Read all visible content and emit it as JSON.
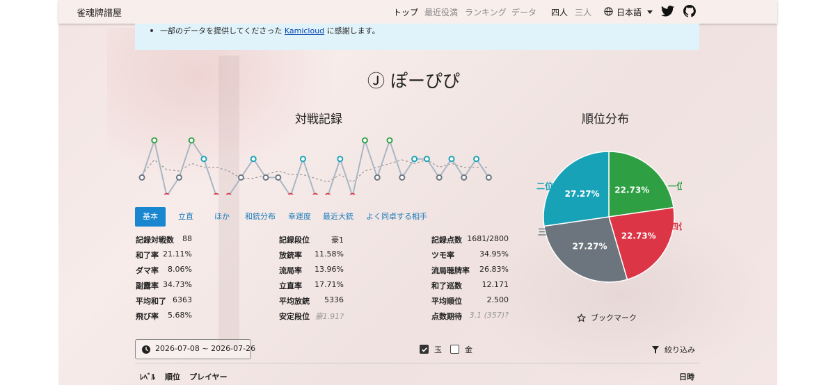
{
  "header": {
    "brand": "雀魂牌譜屋",
    "nav": [
      {
        "label": "トップ",
        "active": true
      },
      {
        "label": "最近役満",
        "active": false
      },
      {
        "label": "ランキング",
        "active": false
      },
      {
        "label": "データ",
        "active": false
      }
    ],
    "modes": [
      {
        "label": "四人",
        "active": true
      },
      {
        "label": "三人",
        "active": false
      }
    ],
    "language": "日本語",
    "icons": [
      "globe-icon",
      "twitter-icon",
      "github-icon"
    ]
  },
  "notice": {
    "prefix": "一部のデータを提供してくださった",
    "link": "Kamicloud",
    "suffix": "に感謝します。"
  },
  "player": {
    "rank_symbol": "Ⓙ",
    "name": "ぽーぴぴ",
    "title": "Ⓙ ぽーぴぴ"
  },
  "sections": {
    "record": "対戦記録",
    "rank_dist": "順位分布"
  },
  "tabs": [
    {
      "label": "基本",
      "active": true
    },
    {
      "label": "立直",
      "active": false
    },
    {
      "label": "ほか",
      "active": false
    },
    {
      "label": "和銃分布",
      "active": false
    },
    {
      "label": "幸運度",
      "active": false
    },
    {
      "label": "最近大銃",
      "active": false
    },
    {
      "label": "よく同卓する相手",
      "active": false
    }
  ],
  "stats": {
    "col1": [
      {
        "label": "記録対戦数",
        "value": "88"
      },
      {
        "label": "和了率",
        "value": "21.11%"
      },
      {
        "label": "ダマ率",
        "value": "8.06%"
      },
      {
        "label": "副露率",
        "value": "34.73%"
      },
      {
        "label": "平均和了",
        "value": "6363"
      },
      {
        "label": "飛び率",
        "value": "5.68%"
      }
    ],
    "col2": [
      {
        "label": "記録段位",
        "value": "豪1"
      },
      {
        "label": "放銃率",
        "value": "11.58%"
      },
      {
        "label": "流局率",
        "value": "13.96%"
      },
      {
        "label": "立直率",
        "value": "17.71%"
      },
      {
        "label": "平均放銃",
        "value": "5336"
      },
      {
        "label": "安定段位",
        "value": "豪1.91?",
        "muted": true
      }
    ],
    "col3": [
      {
        "label": "記録点数",
        "value": "1681/2800"
      },
      {
        "label": "ツモ率",
        "value": "34.95%"
      },
      {
        "label": "流局聴牌率",
        "value": "26.83%"
      },
      {
        "label": "和了巡数",
        "value": "12.171"
      },
      {
        "label": "平均順位",
        "value": "2.500"
      },
      {
        "label": "点数期待",
        "value": "3.1 (357)?",
        "muted": true
      }
    ]
  },
  "chart_data": [
    {
      "type": "line",
      "series": [
        {
          "values": [
            3,
            1,
            4,
            3,
            1,
            2,
            4,
            4,
            3,
            2,
            3,
            3,
            4,
            2,
            4,
            4,
            2,
            4,
            1,
            3,
            1,
            3,
            2,
            2,
            3,
            2,
            3,
            2,
            3
          ]
        }
      ],
      "ylim": [
        1,
        4
      ],
      "point_colors": {
        "1": "#2ea043",
        "2": "#1aa3b8",
        "3": "#6b7682",
        "4": "#d73a49"
      },
      "trend_color": "#888888",
      "grid": false
    },
    {
      "type": "pie",
      "labels": [
        "一位",
        "二位",
        "三位",
        "四位"
      ],
      "values": [
        22.73,
        27.27,
        27.27,
        22.73
      ],
      "value_labels": [
        "22.73%",
        "27.27%",
        "27.27%",
        "22.73%"
      ],
      "colors": [
        "#2ea043",
        "#17a2b8",
        "#6c757d",
        "#dc3545"
      ]
    }
  ],
  "bookmark": "ブックマーク",
  "date_range": "2026-07-08 ~ 2026-07-26",
  "filters": [
    {
      "label": "玉",
      "checked": true
    },
    {
      "label": "金",
      "checked": false
    }
  ],
  "filter_button": "絞り込み",
  "table": {
    "headers": [
      "ﾚﾍﾞﾙ",
      "順位",
      "プレイヤー",
      "日時"
    ]
  }
}
